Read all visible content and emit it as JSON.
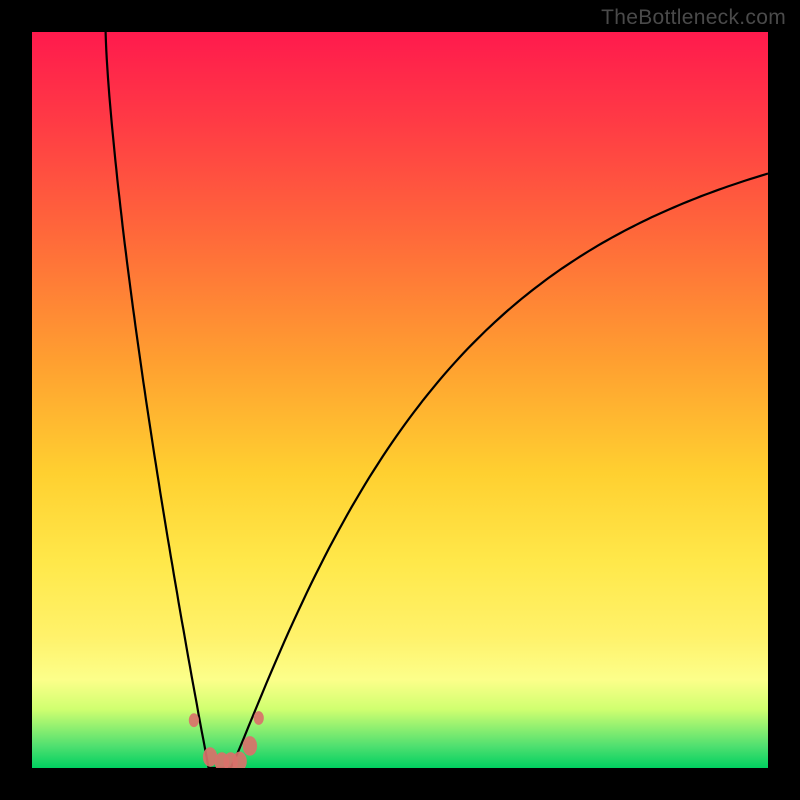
{
  "attribution": "TheBottleneck.com",
  "colors": {
    "frame": "#000000",
    "gradient_top": "#ff1a4d",
    "gradient_bottom": "#00d060",
    "curve": "#000000",
    "marker_fill": "#d9716a",
    "marker_stroke": "#d9716a"
  },
  "chart_data": {
    "type": "line",
    "title": "",
    "xlabel": "",
    "ylabel": "",
    "xlim": [
      0,
      100
    ],
    "ylim": [
      0,
      100
    ],
    "grid": false,
    "legend": false,
    "note": "Values are approximate percentages read from the plot area. The curve is a V-shaped bottleneck curve: left branch drops from y≈100 at x≈10 to y≈0 near x≈24; right branch rises from y≈0 near x≈30 approaching y≈85 at x≈100.",
    "series": [
      {
        "name": "bottleneck-curve",
        "x": [
          10,
          12,
          14,
          16,
          18,
          20,
          22,
          24,
          26,
          28,
          30,
          34,
          40,
          48,
          56,
          64,
          72,
          80,
          88,
          96,
          100
        ],
        "y": [
          100,
          92,
          82,
          70,
          56,
          40,
          22,
          4,
          0,
          0,
          3,
          14,
          30,
          44,
          55,
          63,
          70,
          75,
          80,
          83,
          85
        ]
      }
    ],
    "markers": {
      "name": "highlighted-points",
      "x": [
        22.0,
        24.2,
        25.8,
        27.0,
        28.2,
        29.6,
        30.8
      ],
      "y": [
        6.5,
        1.5,
        0.8,
        0.8,
        0.9,
        3.0,
        6.8
      ]
    }
  }
}
